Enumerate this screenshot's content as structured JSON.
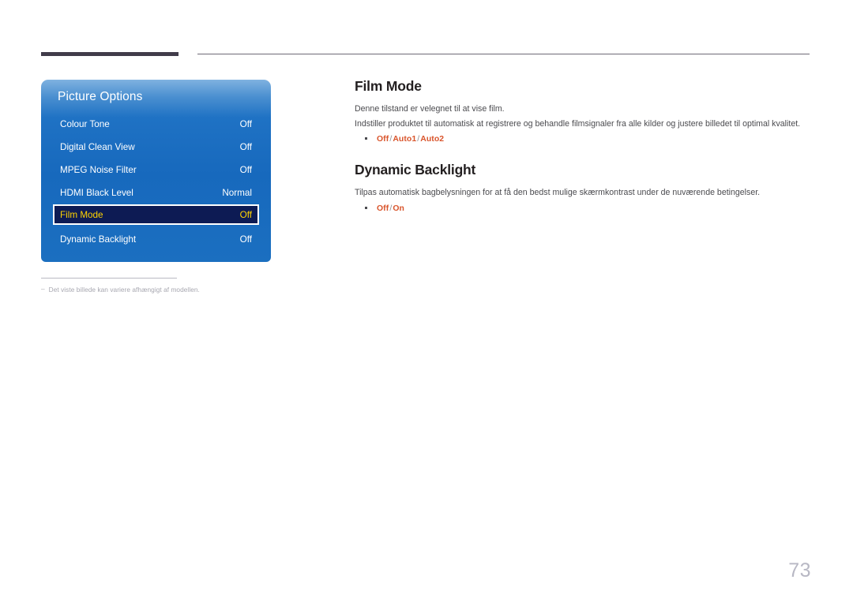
{
  "header": {
    "rule_accent_color": "#413c4a",
    "rule_line_color": "#6e6a75"
  },
  "figure": {
    "osd_menu": {
      "title": "Picture Options",
      "accent_color": "#1769bd",
      "highlight_bg": "#0d1b54",
      "highlight_text_color": "#ffd400",
      "items": [
        {
          "label": "Colour Tone",
          "value": "Off",
          "selected": false
        },
        {
          "label": "Digital Clean View",
          "value": "Off",
          "selected": false
        },
        {
          "label": "MPEG Noise Filter",
          "value": "Off",
          "selected": false
        },
        {
          "label": "HDMI Black Level",
          "value": "Normal",
          "selected": false
        },
        {
          "label": "Film Mode",
          "value": "Off",
          "selected": true
        },
        {
          "label": "Dynamic Backlight",
          "value": "Off",
          "selected": false
        }
      ]
    },
    "note": {
      "dash": "‒",
      "text": "Det viste billede kan variere afhængigt af modellen."
    }
  },
  "content": {
    "sections": [
      {
        "title": "Film Mode",
        "paragraphs": [
          "Denne tilstand er velegnet til at vise film.",
          "Indstiller produktet til automatisk at registrere og behandle filmsignaler fra alle kilder og justere billedet til optimal kvalitet."
        ],
        "options": [
          "Off",
          "Auto1",
          "Auto2"
        ],
        "option_separator": "/",
        "option_color": "#d9542b"
      },
      {
        "title": "Dynamic Backlight",
        "paragraphs": [
          "Tilpas automatisk bagbelysningen for at få den bedst mulige skærmkontrast under de nuværende betingelser."
        ],
        "options": [
          "Off",
          "On"
        ],
        "option_separator": "/",
        "option_color": "#d9542b"
      }
    ]
  },
  "footer": {
    "page_number": "73"
  }
}
